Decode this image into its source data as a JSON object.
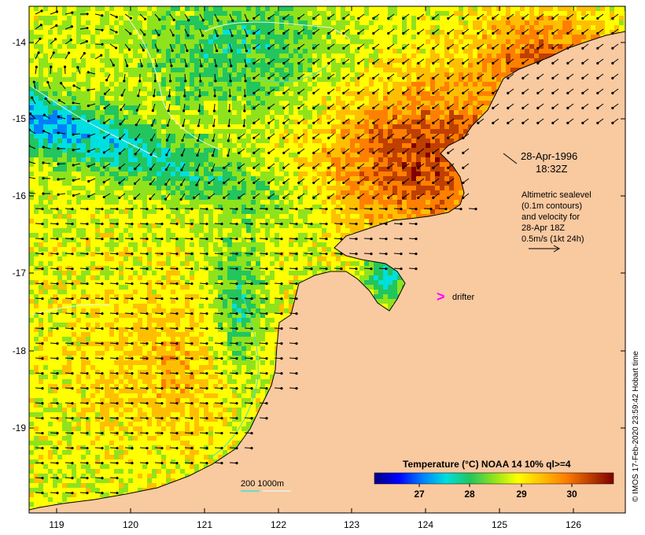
{
  "map": {
    "date_label": "28-Apr-1996",
    "time_label": "18:32Z",
    "legend_lines": [
      "Altimetric sealevel",
      "(0.1m contours)",
      "and velocity for",
      "28-Apr 18Z",
      "0.5m/s (1kt 24h)"
    ],
    "drifter_symbol": ">",
    "drifter_label": "drifter",
    "isobath_label": "200  1000m",
    "credit": "© IMOS 17-Feb-2020 23:59:42 Hobart time",
    "colors": {
      "land": "#f9c9a0",
      "coast": "#000000",
      "drifter": "#ff00ff",
      "isobath": "#40e0d0"
    }
  },
  "axes": {
    "x_ticks": [
      "119",
      "120",
      "121",
      "122",
      "123",
      "124",
      "125",
      "126"
    ],
    "y_ticks": [
      "-14",
      "-15",
      "-16",
      "-17",
      "-18",
      "-19"
    ]
  },
  "colorbar": {
    "title": "Temperature (°C) NOAA 14 10% ql>=4",
    "ticks": [
      "27",
      "28",
      "29",
      "30"
    ],
    "colormap": [
      "#00007f",
      "#0000ff",
      "#007fff",
      "#00dfdf",
      "#22c55e",
      "#8fe31c",
      "#ffff00",
      "#ffbf00",
      "#ff7f00",
      "#bf3f00",
      "#7f0000"
    ]
  }
}
